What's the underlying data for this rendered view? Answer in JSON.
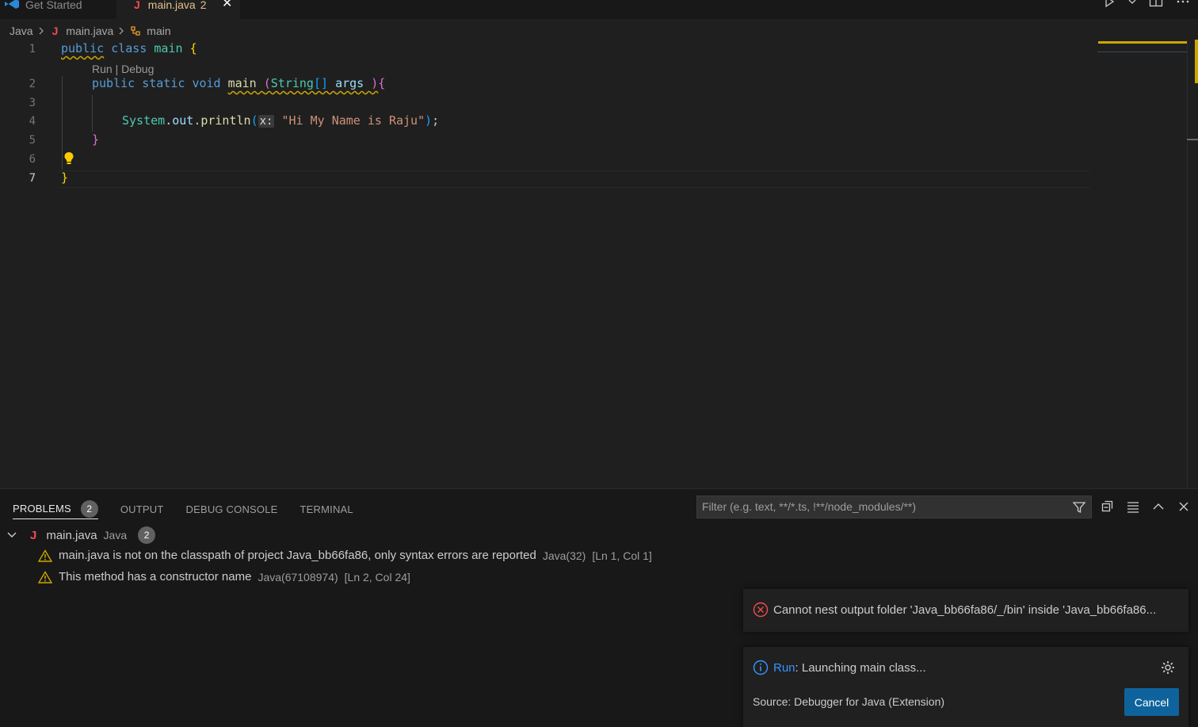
{
  "tabs": {
    "get_started": "Get Started",
    "main_file": "main.java",
    "main_problem_count": "2",
    "close_glyph": "✕",
    "java_glyph": "J"
  },
  "breadcrumb": {
    "folder": "Java",
    "file": "main.java",
    "symbol": "main"
  },
  "editor": {
    "line_numbers": [
      "1",
      "2",
      "3",
      "4",
      "5",
      "6",
      "7"
    ],
    "codelens": "Run | Debug",
    "code": {
      "l1_public": "public",
      "l1_class": "class",
      "l1_name": "main",
      "l1_brace": "{",
      "l2_public": "public",
      "l2_static": "static",
      "l2_void": "void",
      "l2_main": "main",
      "l2_paren_open": "(",
      "l2_string": "String",
      "l2_array": "[]",
      "l2_args": "args",
      "l2_paren_close": ")",
      "l2_brace": "{",
      "l4_system": "System",
      "l4_dot1": ".",
      "l4_out": "out",
      "l4_dot2": ".",
      "l4_println": "println",
      "l4_paren_open": "(",
      "l4_inlay": "x:",
      "l4_string": "\"Hi My Name is Raju\"",
      "l4_paren_close": ")",
      "l4_semi": ";",
      "l5_brace": "}",
      "l7_brace": "}"
    }
  },
  "panel": {
    "tabs": [
      "PROBLEMS",
      "OUTPUT",
      "DEBUG CONSOLE",
      "TERMINAL"
    ],
    "problems_count": "2",
    "filter_placeholder": "Filter (e.g. text, **/*.ts, !**/node_modules/**)",
    "file_group": {
      "name": "main.java",
      "lang": "Java",
      "count": "2"
    },
    "problems": [
      {
        "message": "main.java is not on the classpath of project Java_bb66fa86, only syntax errors are reported",
        "source": "Java(32)",
        "location": "[Ln 1, Col 1]"
      },
      {
        "message": "This method has a constructor name",
        "source": "Java(67108974)",
        "location": "[Ln 2, Col 24]"
      }
    ]
  },
  "notifications": {
    "error": {
      "message": "Cannot nest output folder 'Java_bb66fa86/_/bin' inside 'Java_bb66fa86..."
    },
    "info": {
      "link": "Run",
      "message": ": Launching main class...",
      "source": "Source: Debugger for Java (Extension)",
      "cancel_label": "Cancel"
    }
  },
  "colors": {
    "accent": "#0e639c",
    "warning": "#cca700",
    "error": "#f14c4c",
    "info": "#3794ff"
  }
}
